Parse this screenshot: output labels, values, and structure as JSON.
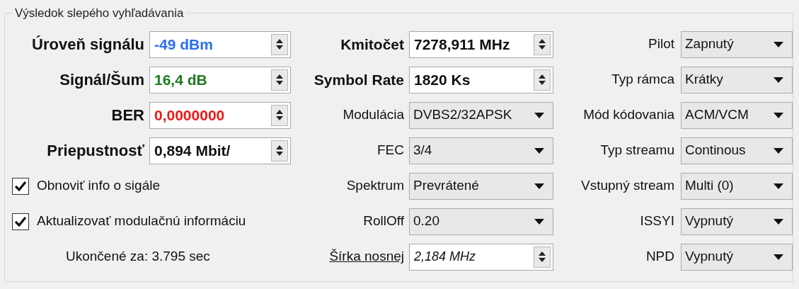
{
  "group": {
    "title": "Výsledok slepého vyhľadávania"
  },
  "left": {
    "fields": [
      {
        "label": "Úroveň signálu",
        "value": "-49 dBm",
        "color": "#2a6ef0"
      },
      {
        "label": "Signál/Šum",
        "value": "16,4 dB",
        "color": "#1f7a1f"
      },
      {
        "label": "BER",
        "value": "0,0000000",
        "color": "#f01818"
      },
      {
        "label": "Priepustnosť",
        "value": "0,894 Mbit/",
        "color": "#111111"
      }
    ],
    "checkboxes": [
      {
        "label": "Obnoviť info o sigále",
        "checked": true
      },
      {
        "label": "Aktualizovať modulačnú informáciu",
        "checked": true
      }
    ],
    "elapsed": "Ukončené za: 3.795 sec"
  },
  "middle": [
    {
      "kind": "bold_spin",
      "label": "Kmitočet",
      "value": "7278,911 MHz"
    },
    {
      "kind": "bold_spin",
      "label": "Symbol Rate",
      "value": "1820 Ks"
    },
    {
      "kind": "combo",
      "label": "Modulácia",
      "value": "DVBS2/32APSK"
    },
    {
      "kind": "combo",
      "label": "FEC",
      "value": "3/4"
    },
    {
      "kind": "combo",
      "label": "Spektrum",
      "value": "Prevrátené"
    },
    {
      "kind": "combo",
      "label": "RollOff",
      "value": "0.20"
    },
    {
      "kind": "link_spin",
      "label": "Šírka nosnej",
      "value": "2,184 MHz"
    }
  ],
  "right": [
    {
      "label": "Pilot",
      "value": "Zapnutý"
    },
    {
      "label": "Typ rámca",
      "value": "Krátky"
    },
    {
      "label": "Mód kódovania",
      "value": "ACM/VCM"
    },
    {
      "label": "Typ streamu",
      "value": "Continous"
    },
    {
      "label": "Vstupný stream",
      "value": "Multi (0)"
    },
    {
      "label": "ISSYI",
      "value": "Vypnutý"
    },
    {
      "label": "NPD",
      "value": "Vypnutý"
    }
  ]
}
